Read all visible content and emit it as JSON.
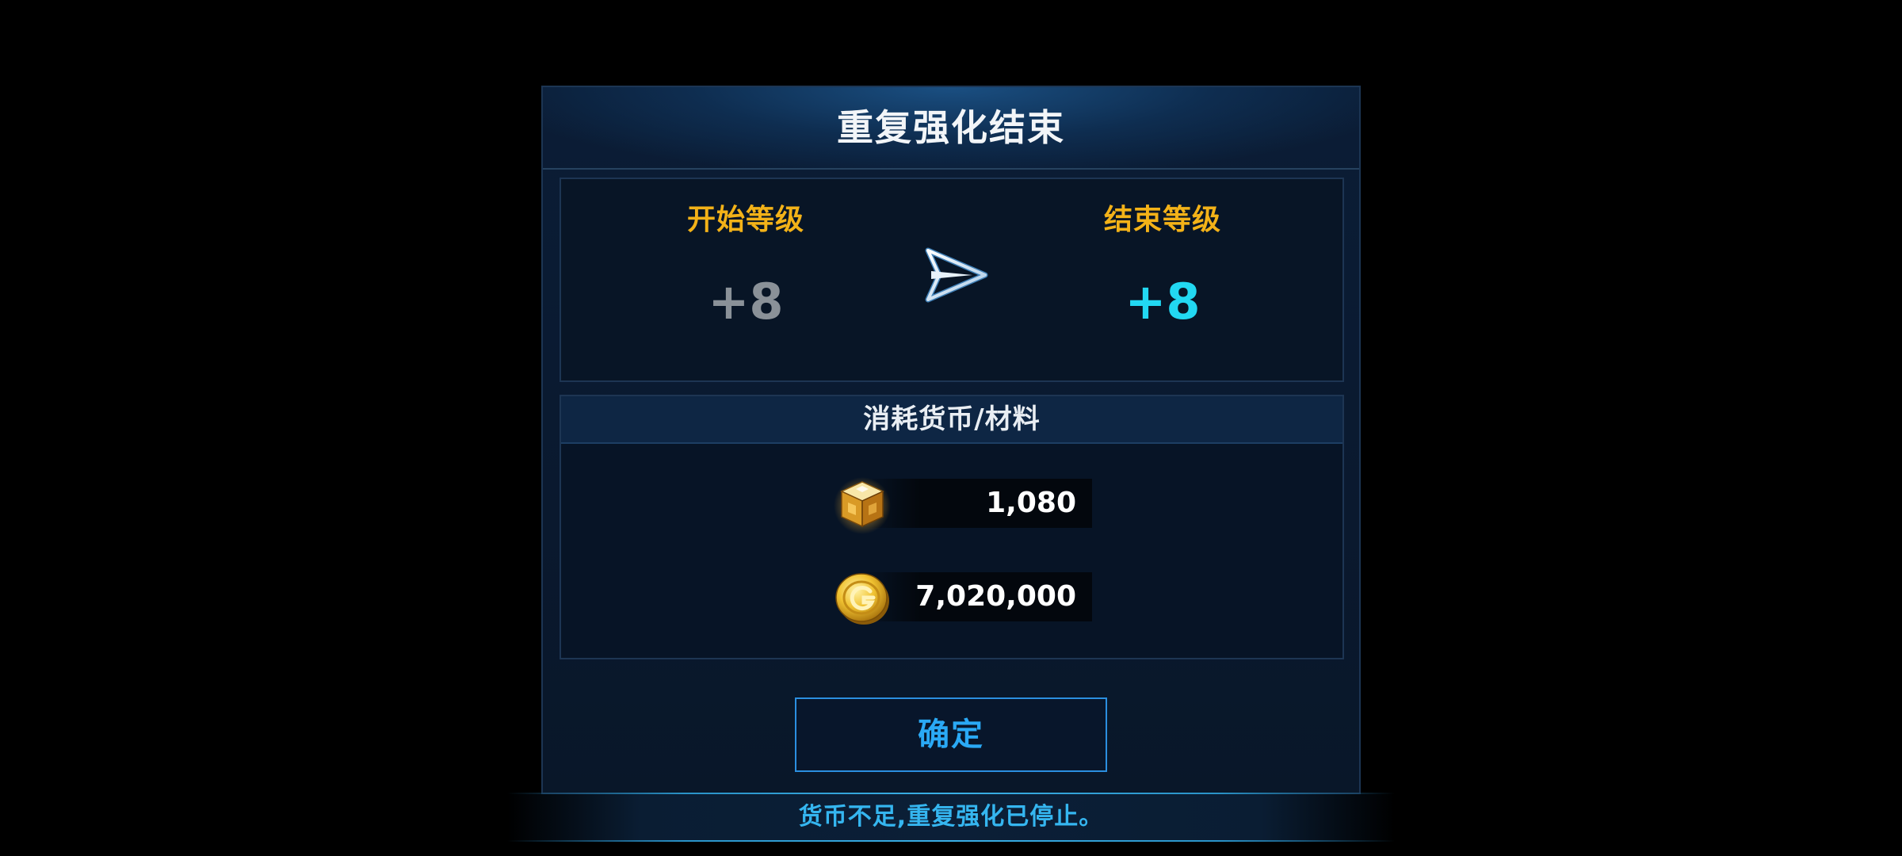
{
  "dialog": {
    "title": "重复强化结束"
  },
  "levels": {
    "start_label": "开始等级",
    "start_value": "+8",
    "end_label": "结束等级",
    "end_value": "+8",
    "arrow_icon": "arrow-right-icon"
  },
  "cost": {
    "header": "消耗货币/材料",
    "items": [
      {
        "icon": "gold-cube-material-icon",
        "amount": "1,080"
      },
      {
        "icon": "gold-coin-icon",
        "amount": "7,020,000"
      }
    ]
  },
  "confirm_button": {
    "label": "确定"
  },
  "toast": {
    "message": "货币不足,重复强化已停止。"
  },
  "colors": {
    "title": "#f2f5f8",
    "level_label": "#f3b218",
    "start_value": "#8a9198",
    "end_value": "#22d8f2",
    "button_accent": "#2aa9f5",
    "toast_text": "#35b6f0"
  }
}
